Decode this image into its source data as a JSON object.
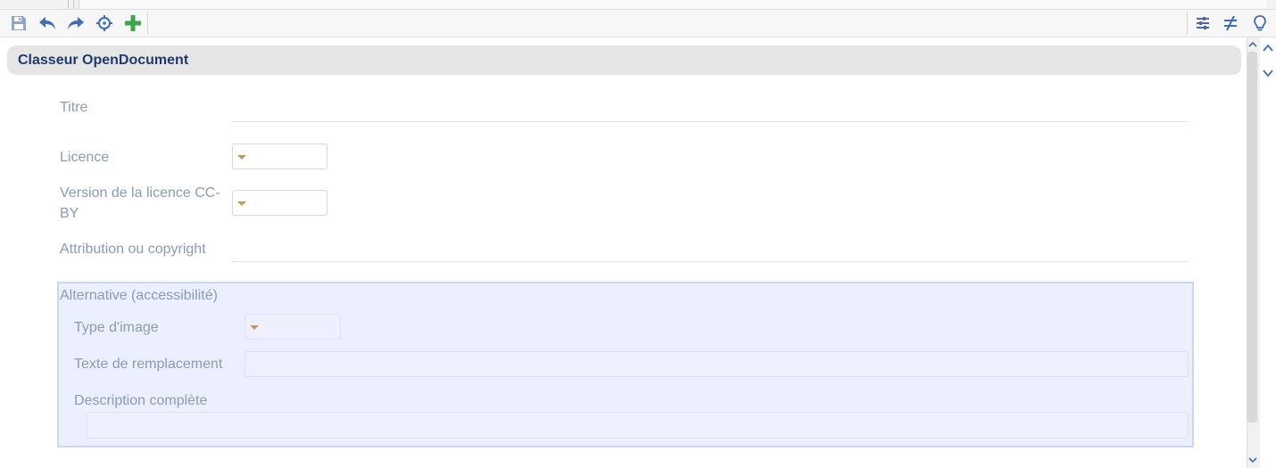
{
  "toolbar": {
    "left_icons": [
      "save-icon",
      "undo-icon",
      "redo-icon",
      "locate-icon",
      "add-icon"
    ],
    "right_icons": [
      "sliders-icon",
      "not-equal-icon",
      "lightbulb-icon"
    ],
    "colors": {
      "icon_blue": "#3e6fb4",
      "add_green": "#3aa84a",
      "save_gray": "#8fa7c8"
    }
  },
  "section": {
    "title": "Classeur OpenDocument"
  },
  "form": {
    "titre_label": "Titre",
    "licence_label": "Licence",
    "version_label_line1": "Version de la licence CC-",
    "version_label_line2": "BY",
    "attribution_label": "Attribution ou copyright"
  },
  "alternative": {
    "legend": "Alternative (accessibilité)",
    "type_image_label": "Type d'image",
    "texte_remplacement_label": "Texte de remplacement",
    "description_label": "Description complète",
    "colors": {
      "background": "#ecefff",
      "border": "#c9d8f3"
    }
  },
  "colors": {
    "label": "#8a9bb5",
    "title": "#1f3a6e",
    "caret": "#c59955"
  }
}
